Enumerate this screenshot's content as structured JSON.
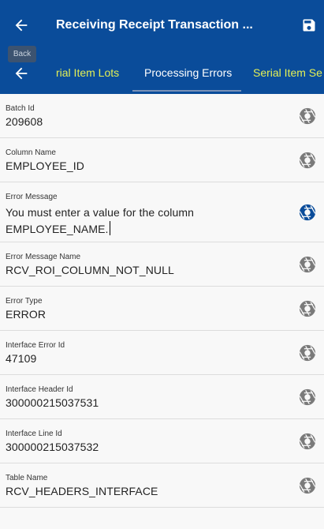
{
  "header": {
    "title": "Receiving Receipt Transaction ...",
    "back_tooltip": "Back"
  },
  "tabs": [
    {
      "label": "rial Item Lots",
      "active": false
    },
    {
      "label": "Processing Errors",
      "active": true
    },
    {
      "label": "Serial Item Se",
      "active": false
    }
  ],
  "fields": [
    {
      "label": "Batch Id",
      "value": "209608"
    },
    {
      "label": "Column Name",
      "value": "EMPLOYEE_ID"
    },
    {
      "label": "Error Message",
      "value": "You must enter a value for the column EMPLOYEE_NAME."
    },
    {
      "label": "Error Message Name",
      "value": "RCV_ROI_COLUMN_NOT_NULL"
    },
    {
      "label": "Error Type",
      "value": "ERROR"
    },
    {
      "label": "Interface Error Id",
      "value": "47109"
    },
    {
      "label": "Interface Header Id",
      "value": "300000215037531"
    },
    {
      "label": "Interface Line Id",
      "value": "300000215037532"
    },
    {
      "label": "Table Name",
      "value": "RCV_HEADERS_INTERFACE"
    }
  ],
  "colors": {
    "header_bg": "#0a4c9a",
    "inactive_tab": "#e3ef55",
    "aperture_default": "#7a7a7a",
    "aperture_active": "#0a4c9a"
  },
  "icons": {
    "back": "arrow-left-icon",
    "save": "floppy-disk-icon",
    "field_action": "camera-aperture-icon"
  }
}
